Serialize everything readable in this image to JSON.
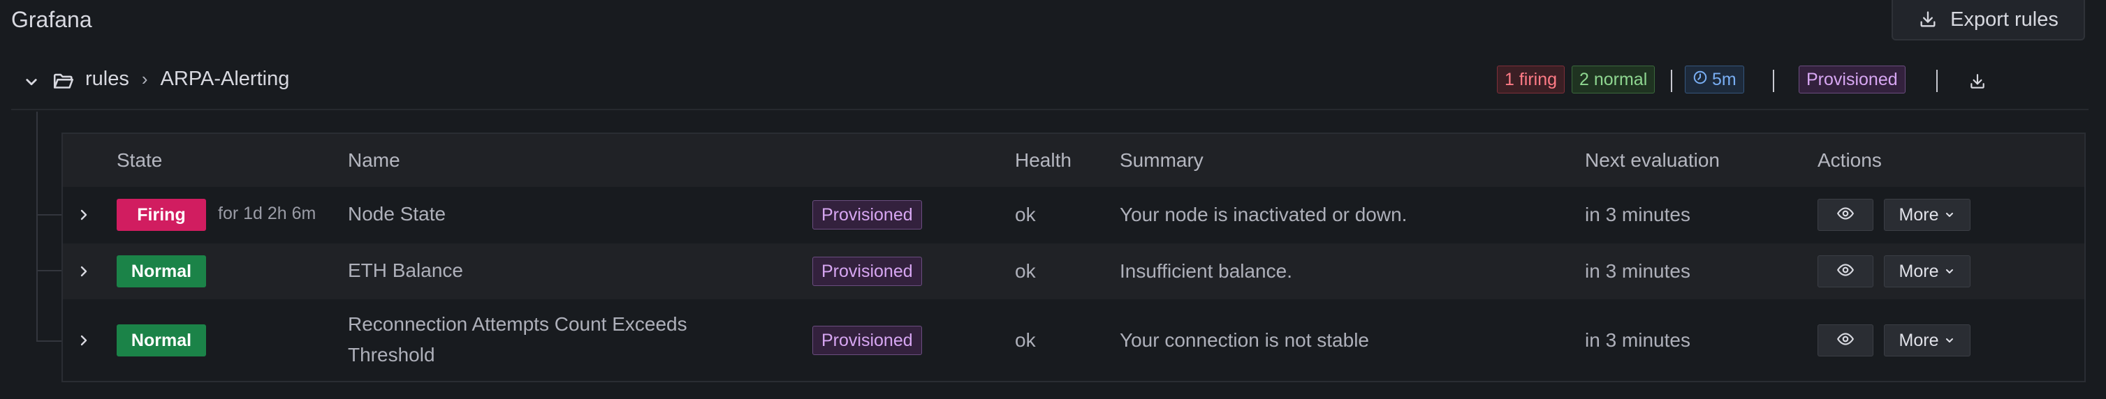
{
  "app": {
    "title": "Grafana",
    "export_label": "Export rules"
  },
  "group": {
    "breadcrumb": [
      "rules",
      "ARPA-Alerting"
    ],
    "firing_count": "1 firing",
    "normal_count": "2 normal",
    "interval": "5m",
    "provisioned_label": "Provisioned"
  },
  "table": {
    "headers": {
      "state": "State",
      "name": "Name",
      "health": "Health",
      "summary": "Summary",
      "next_evaluation": "Next evaluation",
      "actions": "Actions"
    },
    "rows": [
      {
        "state": "Firing",
        "duration": "for 1d 2h 6m",
        "name": "Node State",
        "provisioned": "Provisioned",
        "health": "ok",
        "summary": "Your node is inactivated or down.",
        "next_evaluation": "in 3 minutes",
        "more_label": "More"
      },
      {
        "state": "Normal",
        "duration": "",
        "name": "ETH Balance",
        "provisioned": "Provisioned",
        "health": "ok",
        "summary": "Insufficient balance.",
        "next_evaluation": "in 3 minutes",
        "more_label": "More"
      },
      {
        "state": "Normal",
        "duration": "",
        "name": "Reconnection Attempts Count Exceeds Threshold",
        "provisioned": "Provisioned",
        "health": "ok",
        "summary": "Your connection is not stable",
        "next_evaluation": "in 3 minutes",
        "more_label": "More"
      }
    ]
  },
  "colors": {
    "background": "#181b1f",
    "firing": "#d11d60",
    "normal": "#1b8348",
    "provisioned": "#d7a6f2"
  },
  "icons": {
    "export": "download-icon",
    "collapse": "chevron-down-icon",
    "folder": "folder-open-icon",
    "interval": "clock-icon",
    "row_expand": "chevron-right-icon",
    "view": "eye-icon",
    "more": "caret-down-icon"
  }
}
